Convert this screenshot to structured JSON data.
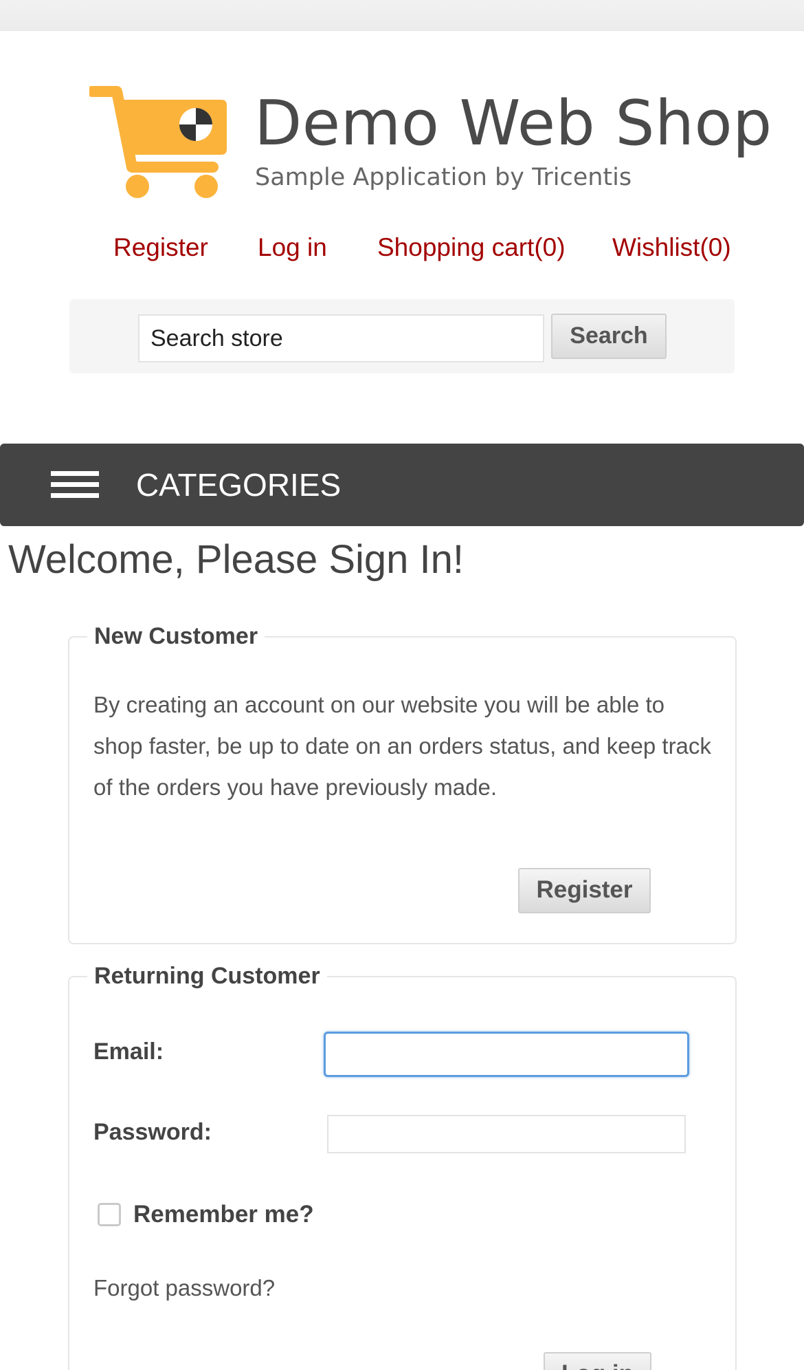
{
  "logo": {
    "title": "Demo Web Shop",
    "subtitle": "Sample Application by Tricentis",
    "icon": "shopping-cart-icon",
    "accent_color": "#fbb33c"
  },
  "header": {
    "links": {
      "register": "Register",
      "login": "Log in",
      "cart": "Shopping cart(0)",
      "wishlist": "Wishlist(0)"
    },
    "link_color": "#a30000"
  },
  "search": {
    "value": "Search store",
    "button_label": "Search"
  },
  "nav": {
    "categories_label": "CATEGORIES",
    "menu_icon": "hamburger-menu-icon",
    "bar_color": "#444444"
  },
  "page": {
    "title": "Welcome, Please Sign In!"
  },
  "new_customer": {
    "legend": "New Customer",
    "description": "By creating an account on our website you will be able to shop faster, be up to date on an orders status, and keep track of the orders you have previously made.",
    "register_button": "Register"
  },
  "returning_customer": {
    "legend": "Returning Customer",
    "email_label": "Email:",
    "email_value": "",
    "password_label": "Password:",
    "password_value": "",
    "remember_label": "Remember me?",
    "remember_checked": false,
    "forgot_link": "Forgot password?",
    "login_button": "Log in"
  }
}
